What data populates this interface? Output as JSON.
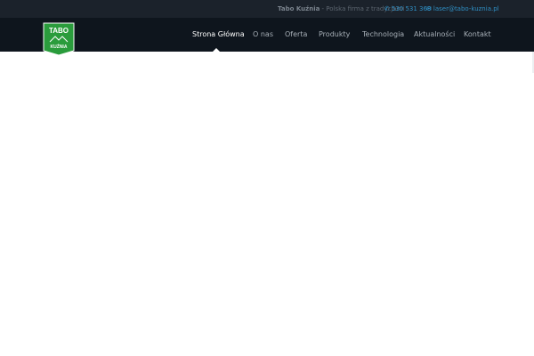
{
  "topbar": {
    "company": "Tabo Kuźnia",
    "tagline": " - Polska firma z tradycjami",
    "phone": "530 531 360",
    "email": "laser@tabo-kuznia.pl",
    "icons": {
      "phone": "phone-icon",
      "email": "envelope-icon"
    }
  },
  "logo": {
    "line1": "TABO",
    "line2": "KUŹNIA",
    "brand_color": "#2a9c3c"
  },
  "nav": {
    "items": [
      {
        "label": "Strona Główna",
        "active": true
      },
      {
        "label": "O nas"
      },
      {
        "label": "Oferta"
      },
      {
        "label": "Produkty"
      },
      {
        "label": "Technologia"
      },
      {
        "label": "Aktualności"
      },
      {
        "label": "Kontakt"
      }
    ]
  },
  "colors": {
    "topbar_bg": "#1b222b",
    "navbar_bg": "#0e151d",
    "link_blue": "#2f8fc4",
    "page_bg": "#ffffff"
  }
}
